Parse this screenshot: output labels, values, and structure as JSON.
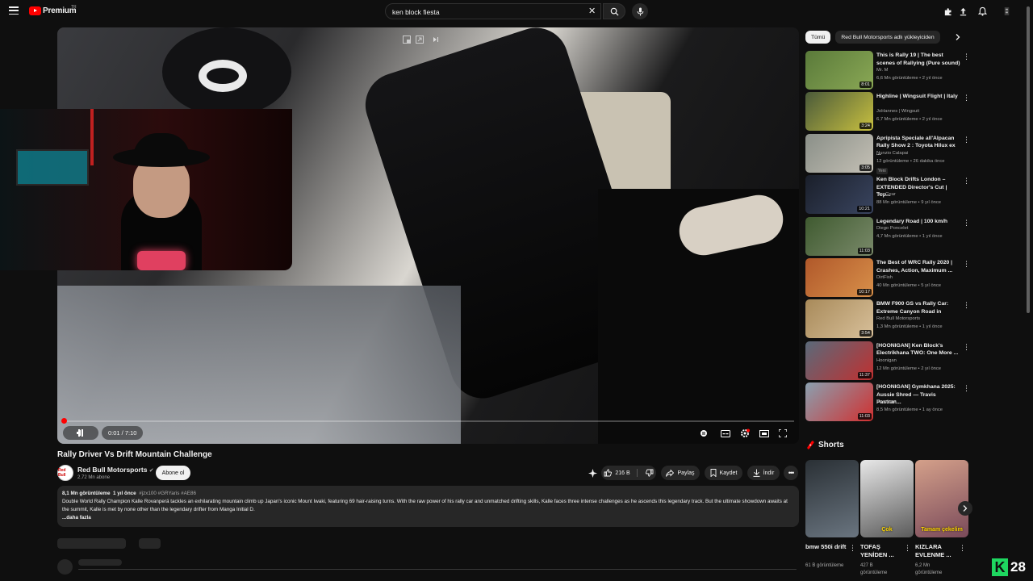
{
  "header": {
    "logo_text": "Premium",
    "logo_cc": "TR",
    "search_value": "ken block fiesta"
  },
  "video": {
    "time": "0:01 / 7:10",
    "progress": 0.003,
    "title": "Rally Driver Vs Drift Mountain Challenge",
    "channel": "Red Bull Motorsports",
    "channel_avatar_text": "Red Bull",
    "subscribers": "2,72 Mn abone",
    "subscribe_label": "Abone ol",
    "likes": "216 B",
    "share_label": "Paylaş",
    "save_label": "Kaydet",
    "download_label": "İndir"
  },
  "description": {
    "views": "8,1 Mn görüntüleme",
    "date": "1 yıl önce",
    "tags": "#jzx100 #GRYaris #AE86",
    "text": "Double World Rally Champion Kalle Rovanperä tackles an exhilarating mountain climb up Japan's iconic Mount Iwaki, featuring 69 hair-raising turns. With the raw power of his rally car and unmatched drifting skills, Kalle faces three intense challenges as he ascends this legendary track. But the ultimate showdown awaits at the summit, Kalle is met by none other than the legendary drifter from Manga Initial D.",
    "more": "...daha fazla"
  },
  "chips": [
    "Tümü",
    "Red Bull Motorsports adlı yükleyiciden"
  ],
  "recommendations": [
    {
      "title": "This is Rally 19 | The best scenes of Rallying (Pure sound)",
      "channel": "Mr. M",
      "meta": "6,6 Mn görüntüleme • 2 yıl önce",
      "duration": "8:01",
      "color": "#5a7a3a",
      "color2": "#8aa855"
    },
    {
      "title": "Highline | Wingsuit Flight | Italy",
      "channel": "JoHannes | Wingsuit",
      "meta": "6,7 Mn görüntüleme • 2 yıl önce",
      "duration": "3:24",
      "color": "#4a5a3a",
      "color2": "#c8c040"
    },
    {
      "title": "Apripista Speciale all'Alpacan Rally Show 2 : Toyota Hilux ex ...",
      "channel": "Nunzio Calapai",
      "meta": "12 görüntüleme • 26 dakika önce",
      "duration": "3:05",
      "color": "#8a8f88",
      "color2": "#c4c0b5",
      "badge": "Yeni"
    },
    {
      "title": "Ken Block Drifts London – EXTENDED Director's Cut | Top...",
      "channel": "Top Gear",
      "meta": "88 Mn görüntüleme • 9 yıl önce",
      "duration": "10:21",
      "color": "#1a1f2a",
      "color2": "#3a4560"
    },
    {
      "title": "Legendary Road | 100 km/h",
      "channel": "Diego Poncelet",
      "meta": "4,7 Mn görüntüleme • 1 yıl önce",
      "duration": "11:03",
      "color": "#3f5a30",
      "color2": "#7a8a6a"
    },
    {
      "title": "The Best of WRC Rally 2020 | Crashes, Action, Maximum ...",
      "channel": "DirtFish",
      "meta": "40 Mn görüntüleme • 5 yıl önce",
      "duration": "10:17",
      "color": "#b0582a",
      "color2": "#d8904a"
    },
    {
      "title": "BMW F900 GS vs Rally Car: Extreme Canyon Road in",
      "channel": "Red Bull Motorsports",
      "meta": "1,3 Mn görüntüleme • 1 yıl önce",
      "duration": "3:54",
      "color": "#a88a5a",
      "color2": "#d8c09a"
    },
    {
      "title": "[HOONIGAN] Ken Block's Electrikhana TWO: One More ...",
      "channel": "Hoonigan",
      "meta": "12 Mn görüntüleme • 2 yıl önce",
      "duration": "11:37",
      "color": "#5a6a7a",
      "color2": "#c03030"
    },
    {
      "title": "[HOONIGAN] Gymkhana 2025: Aussie Shred — Travis Pastran...",
      "channel": "Hoonigan",
      "meta": "8,5 Mn görüntüleme • 1 ay önce",
      "duration": "11:03",
      "color": "#8aa0b0",
      "color2": "#d03030"
    }
  ],
  "shorts": {
    "heading": "Shorts",
    "items": [
      {
        "title": "bmw 550i drift",
        "views": "61 B görüntüleme",
        "color": "#2a3035",
        "color2": "#6a7580"
      },
      {
        "title": "TOFAŞ YENİDEN ...",
        "views": "427 B görüntüleme",
        "color": "#e8e8e8",
        "color2": "#5a5a5a",
        "label": "Çok"
      },
      {
        "title": "KIZLARA EVLENME ...",
        "views": "6,2 Mn görüntüleme",
        "color": "#d4a08a",
        "color2": "#7a4a5a",
        "label": "Tamam çekelim"
      }
    ]
  },
  "badge_count": "28"
}
